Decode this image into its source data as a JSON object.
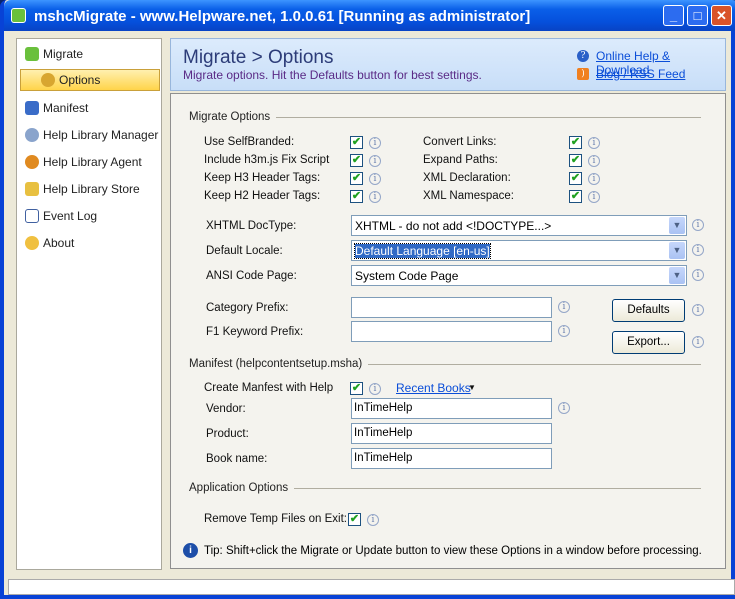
{
  "window": {
    "title": "mshcMigrate - www.Helpware.net, 1.0.0.61 [Running as administrator]"
  },
  "sidebar": {
    "items": [
      {
        "label": "Migrate"
      },
      {
        "label": "Options"
      },
      {
        "label": "Manifest"
      },
      {
        "label": "Help Library Manager"
      },
      {
        "label": "Help Library Agent"
      },
      {
        "label": "Help Library Store"
      },
      {
        "label": "Event Log"
      },
      {
        "label": "About"
      }
    ]
  },
  "header": {
    "title": "Migrate > Options",
    "subtitle": "Migrate options. Hit the Defaults button for best settings.",
    "help_link": "Online Help & Download",
    "blog_link": "Blog / RSS Feed"
  },
  "migrate_options": {
    "heading": "Migrate Options",
    "left": [
      {
        "label": "Use SelfBranded:",
        "checked": true
      },
      {
        "label": "Include h3m.js Fix Script",
        "checked": true
      },
      {
        "label": "Keep H3 Header Tags:",
        "checked": true
      },
      {
        "label": "Keep H2 Header Tags:",
        "checked": true
      }
    ],
    "right": [
      {
        "label": "Convert Links:",
        "checked": true
      },
      {
        "label": "Expand Paths:",
        "checked": true
      },
      {
        "label": "XML Declaration:",
        "checked": true
      },
      {
        "label": "XML Namespace:",
        "checked": true
      }
    ],
    "xhtml_doctype": {
      "label": "XHTML DocType:",
      "value": "XHTML - do not add <!DOCTYPE...>"
    },
    "default_locale": {
      "label": "Default Locale:",
      "value": "Default Language [en-us]"
    },
    "ansi_code_page": {
      "label": "ANSI Code Page:",
      "value": "System Code Page"
    },
    "category_prefix": {
      "label": "Category Prefix:",
      "value": ""
    },
    "f1_prefix": {
      "label": "F1 Keyword Prefix:",
      "value": ""
    },
    "defaults_button": "Defaults",
    "export_button": "Export..."
  },
  "manifest": {
    "heading": "Manifest (helpcontentsetup.msha)",
    "create_label": "Create Manfest with Help",
    "create_checked": true,
    "recent_books": "Recent Books",
    "vendor": {
      "label": "Vendor:",
      "value": "InTimeHelp"
    },
    "product": {
      "label": "Product:",
      "value": "InTimeHelp"
    },
    "book_name": {
      "label": "Book name:",
      "value": "InTimeHelp"
    }
  },
  "app_options": {
    "heading": "Application Options",
    "remove_temp_label": "Remove Temp Files on Exit:",
    "remove_temp_checked": true
  },
  "tip": "Tip: Shift+click the Migrate or Update button to view these Options in a window before processing.",
  "check_glyph": "✔",
  "info_glyph": "i",
  "arrow_glyph": "▼"
}
